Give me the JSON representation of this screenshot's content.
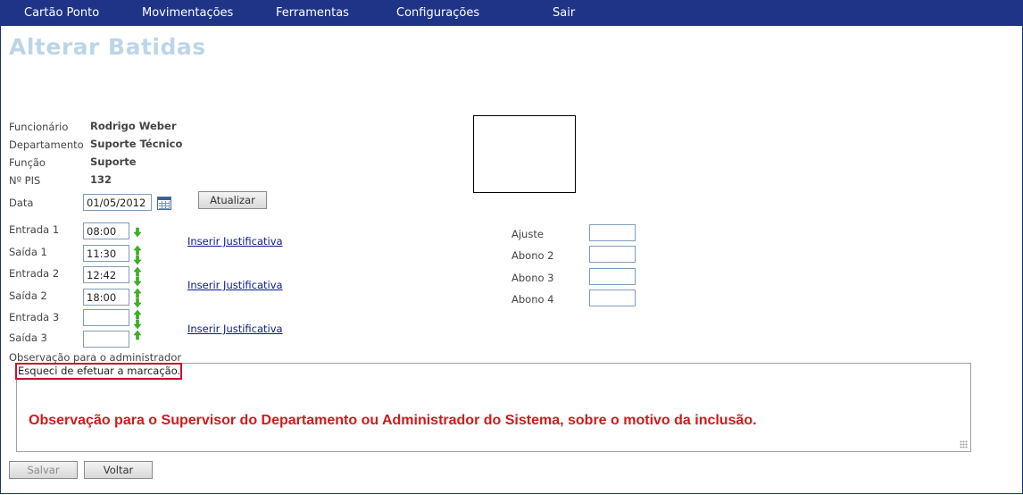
{
  "menu": {
    "items": [
      {
        "label": "Cartão Ponto"
      },
      {
        "label": "Movimentações"
      },
      {
        "label": "Ferramentas"
      },
      {
        "label": "Configurações"
      },
      {
        "label": "Sair"
      }
    ]
  },
  "page": {
    "title": "Alterar Batidas"
  },
  "employee": {
    "name_label": "Funcionário",
    "name_value": "Rodrigo Weber",
    "dept_label": "Departamento",
    "dept_value": "Suporte Técnico",
    "role_label": "Função",
    "role_value": "Suporte",
    "pis_label": "Nº PIS",
    "pis_value": "132"
  },
  "date": {
    "label": "Data",
    "value": "01/05/2012",
    "update_button": "Atualizar"
  },
  "punches": [
    {
      "label": "Entrada 1",
      "value": "08:00"
    },
    {
      "label": "Saída 1",
      "value": "11:30"
    },
    {
      "label": "Entrada 2",
      "value": "12:42"
    },
    {
      "label": "Saída 2",
      "value": "18:00"
    },
    {
      "label": "Entrada 3",
      "value": ""
    },
    {
      "label": "Saída 3",
      "value": ""
    }
  ],
  "justification_link": "Inserir Justificativa",
  "adjustments": [
    {
      "label": "Ajuste",
      "value": ""
    },
    {
      "label": "Abono 2",
      "value": ""
    },
    {
      "label": "Abono 3",
      "value": ""
    },
    {
      "label": "Abono 4",
      "value": ""
    }
  ],
  "observation": {
    "label": "Observação para o administrador",
    "value": "Esqueci de efetuar a marcação.",
    "annotation": "Observação para o Supervisor do Departamento ou Administrador do Sistema, sobre o motivo da inclusão."
  },
  "actions": {
    "save": "Salvar",
    "back": "Voltar"
  },
  "colors": {
    "menu_bg": "#1f3486",
    "title": "#bcd5e8",
    "link": "#0b1a8f",
    "annotation": "#d21a1a",
    "arrow": "#3cb521"
  }
}
